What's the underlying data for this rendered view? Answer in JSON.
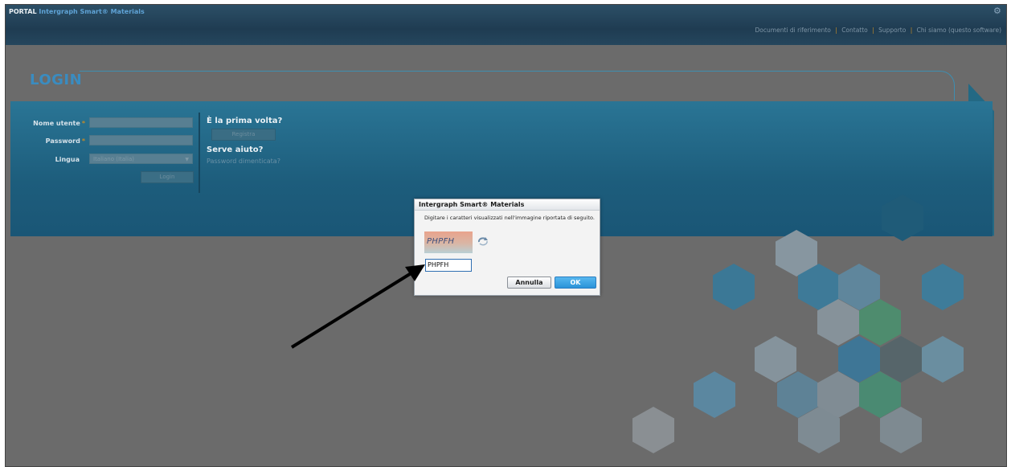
{
  "header": {
    "brand_prefix": "PORTAL",
    "brand_product": "Intergraph Smart® Materials",
    "links": [
      "Documenti di riferimento",
      "Contatto",
      "Supporto",
      "Chi siamo (questo software)"
    ],
    "separator": "|",
    "corner_icon": "user-settings-icon"
  },
  "login": {
    "title": "LOGIN",
    "username_label": "Nome utente",
    "password_label": "Password",
    "language_label": "Lingua",
    "required_mark": "*",
    "language_value": "Italiano (Italia)",
    "login_button": "Login",
    "first_time_title": "È la prima volta?",
    "register_button": "Registra",
    "help_title": "Serve aiuto?",
    "forgot_password_link": "Password dimenticata?"
  },
  "dialog": {
    "title": "Intergraph Smart® Materials",
    "message": "Digitare i caratteri visualizzati nell'immagine riportata di seguito.",
    "captcha_text": "PHPFH",
    "input_value": "PHPFH",
    "cancel_button": "Annulla",
    "ok_button": "OK",
    "refresh_icon": "refresh-icon"
  },
  "colors": {
    "accent_blue": "#3a8cc0",
    "panel_teal": "#1d5d7c",
    "required_orange": "#c08a2a",
    "ok_blue": "#2b93d8"
  }
}
